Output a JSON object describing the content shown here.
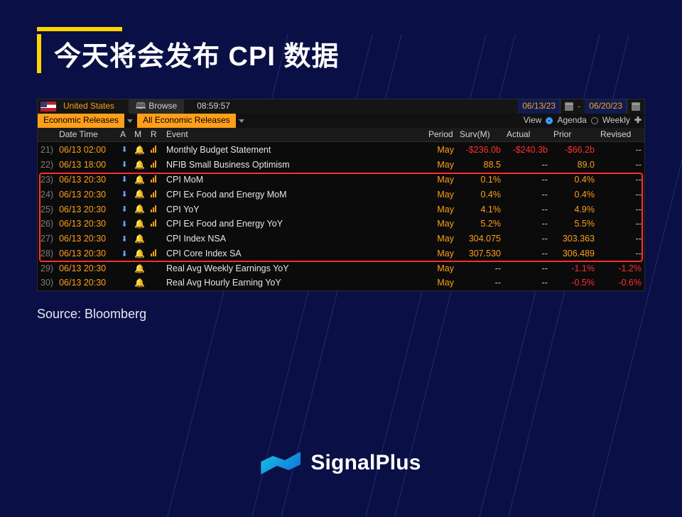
{
  "title": "今天将会发布 CPI 数据",
  "source_line": "Source: Bloomberg",
  "brand": {
    "name": "SignalPlus"
  },
  "terminal": {
    "top": {
      "country": "United States",
      "browse_label": "Browse",
      "clock": "08:59:57",
      "date_from": "06/13/23",
      "date_to": "06/20/23"
    },
    "filters": {
      "scope": "Economic Releases",
      "subset": "All Economic Releases",
      "view_label": "View",
      "agenda_label": "Agenda",
      "weekly_label": "Weekly"
    },
    "columns": {
      "datetime": "Date Time",
      "a": "A",
      "m": "M",
      "r": "R",
      "event": "Event",
      "period": "Period",
      "surv": "Surv(M)",
      "actual": "Actual",
      "prior": "Prior",
      "revised": "Revised"
    },
    "rows": [
      {
        "idx": "21)",
        "dt": "06/13 02:00",
        "a": true,
        "m": true,
        "r": "bars",
        "event": "Monthly Budget Statement",
        "period": "May",
        "surv": "-$236.0b",
        "actual": "-$240.3b",
        "prior": "-$66.2b",
        "revised": "--",
        "hl": false
      },
      {
        "idx": "22)",
        "dt": "06/13 18:00",
        "a": true,
        "m": true,
        "r": "bars",
        "event": "NFIB Small Business Optimism",
        "period": "May",
        "surv": "88.5",
        "actual": "--",
        "prior": "89.0",
        "revised": "--",
        "hl": false
      },
      {
        "idx": "23)",
        "dt": "06/13 20:30",
        "a": true,
        "m": true,
        "r": "bars",
        "event": "CPI MoM",
        "period": "May",
        "surv": "0.1%",
        "actual": "--",
        "prior": "0.4%",
        "revised": "--",
        "hl": true
      },
      {
        "idx": "24)",
        "dt": "06/13 20:30",
        "a": true,
        "m": true,
        "r": "bars",
        "event": "CPI Ex Food and Energy MoM",
        "period": "May",
        "surv": "0.4%",
        "actual": "--",
        "prior": "0.4%",
        "revised": "--",
        "hl": true
      },
      {
        "idx": "25)",
        "dt": "06/13 20:30",
        "a": true,
        "m": true,
        "r": "bars",
        "event": "CPI YoY",
        "period": "May",
        "surv": "4.1%",
        "actual": "--",
        "prior": "4.9%",
        "revised": "--",
        "hl": true
      },
      {
        "idx": "26)",
        "dt": "06/13 20:30",
        "a": true,
        "m": true,
        "r": "bars",
        "event": "CPI Ex Food and Energy YoY",
        "period": "May",
        "surv": "5.2%",
        "actual": "--",
        "prior": "5.5%",
        "revised": "--",
        "hl": true
      },
      {
        "idx": "27)",
        "dt": "06/13 20:30",
        "a": true,
        "m": true,
        "r": "",
        "event": "CPI Index NSA",
        "period": "May",
        "surv": "304.075",
        "actual": "--",
        "prior": "303.363",
        "revised": "--",
        "hl": true
      },
      {
        "idx": "28)",
        "dt": "06/13 20:30",
        "a": true,
        "m": true,
        "r": "bars",
        "event": "CPI Core Index SA",
        "period": "May",
        "surv": "307.530",
        "actual": "--",
        "prior": "306.489",
        "revised": "--",
        "hl": true
      },
      {
        "idx": "29)",
        "dt": "06/13 20:30",
        "a": false,
        "m": true,
        "r": "",
        "event": "Real Avg Weekly Earnings YoY",
        "period": "May",
        "surv": "--",
        "actual": "--",
        "prior": "-1.1%",
        "revised": "-1.2%",
        "hl": false
      },
      {
        "idx": "30)",
        "dt": "06/13 20:30",
        "a": false,
        "m": true,
        "r": "",
        "event": "Real Avg Hourly Earning YoY",
        "period": "May",
        "surv": "--",
        "actual": "--",
        "prior": "-0.5%",
        "revised": "-0.6%",
        "hl": false
      }
    ]
  }
}
